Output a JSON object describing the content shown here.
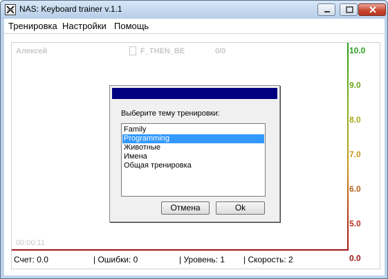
{
  "window": {
    "title": "NAS:  Keyboard trainer v.1.1"
  },
  "menu": {
    "items": [
      "Тренировка",
      "Настройки",
      "Помощь"
    ]
  },
  "board": {
    "user": "Алексей",
    "word": "F_THEN_BE",
    "ratio": "0/0",
    "timer": "00:00:11",
    "scale": [
      {
        "label": "10.0",
        "color": "#2a9d1a"
      },
      {
        "label": "9.0",
        "color": "#6aa419"
      },
      {
        "label": "8.0",
        "color": "#a9a817"
      },
      {
        "label": "7.0",
        "color": "#c49515"
      },
      {
        "label": "6.0",
        "color": "#b8621a"
      },
      {
        "label": "5.0",
        "color": "#b8321a"
      },
      {
        "label": "0.0",
        "color": "#a01515"
      }
    ]
  },
  "status": {
    "score": "Счет:  0.0",
    "errors": "| Ошибки:  0",
    "level": "| Уровень:  1",
    "speed": "| Скорость:  2"
  },
  "dialog": {
    "prompt": "Выберите тему тренировки:",
    "options": [
      "Family",
      "Programming",
      "Животные",
      "Имена",
      "Общая тренировка"
    ],
    "selected_index": 1,
    "cancel_label": "Отмена",
    "ok_label": "Ok"
  },
  "colors": {
    "dialog_title": "#000080",
    "selection": "#3399ff"
  }
}
